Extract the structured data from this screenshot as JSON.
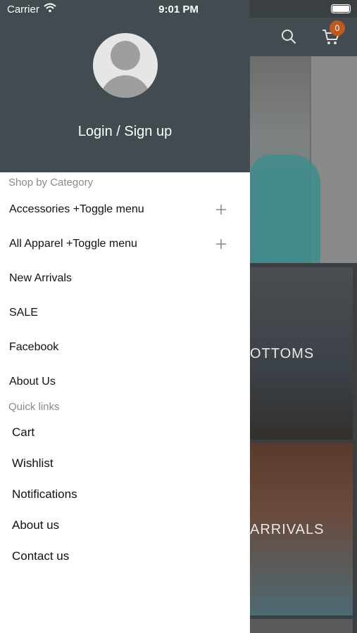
{
  "statusbar": {
    "carrier": "Carrier",
    "time": "9:01 PM"
  },
  "header": {
    "cart_count": "0"
  },
  "background": {
    "tile1_label": "OTTOMS",
    "tile2_label": "ARRIVALS"
  },
  "drawer": {
    "login_label": "Login / Sign up",
    "shop_section_title": "Shop by Category",
    "categories": [
      {
        "label": "Accessories +Toggle menu",
        "expandable": true
      },
      {
        "label": "All Apparel +Toggle menu",
        "expandable": true
      },
      {
        "label": "New Arrivals",
        "expandable": false
      },
      {
        "label": "SALE",
        "expandable": false
      },
      {
        "label": "Facebook",
        "expandable": false
      },
      {
        "label": "About Us",
        "expandable": false
      }
    ],
    "quick_section_title": "Quick links",
    "quick_links": [
      {
        "label": "Cart"
      },
      {
        "label": "Wishlist"
      },
      {
        "label": "Notifications"
      },
      {
        "label": "About us"
      },
      {
        "label": "Contact us"
      }
    ]
  },
  "colors": {
    "drawer_header": "#424c50",
    "badge": "#c0591f",
    "section_title": "#8a8a8a"
  }
}
